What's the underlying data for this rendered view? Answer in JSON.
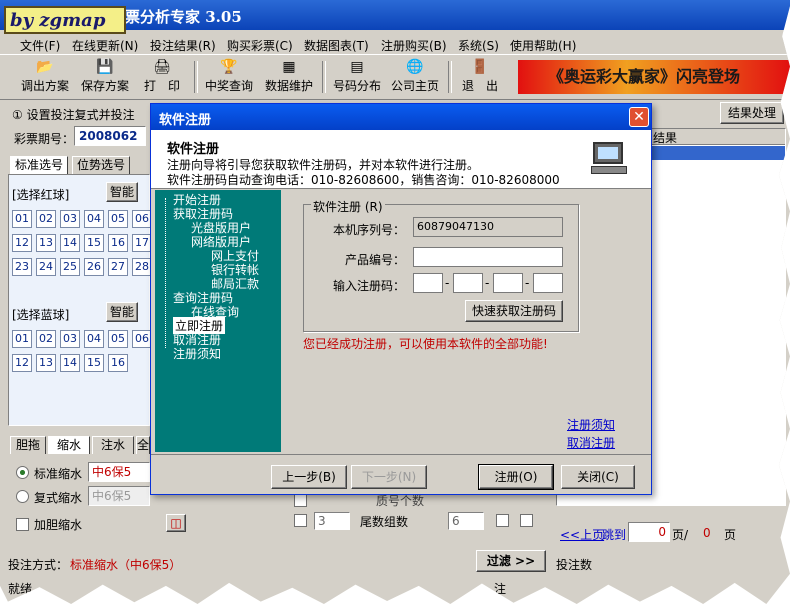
{
  "app": {
    "title": "彩票分析专家 3.05",
    "logo_text": "by zgmap"
  },
  "menu": [
    "文件(F)",
    "在线更新(N)",
    "投注结果(R)",
    "购买彩票(C)",
    "数据图表(T)",
    "注册购买(B)",
    "系统(S)",
    "使用帮助(H)"
  ],
  "toolbar": {
    "items": [
      "调出方案",
      "保存方案",
      "打　印",
      "中奖查询",
      "数据维护",
      "号码分布",
      "公司主页",
      "退　出"
    ],
    "banner": "《奥运彩大赢家》闪亮登场"
  },
  "left": {
    "step_title": "① 设置投注复式并投注",
    "period_label": "彩票期号：",
    "period_value": "2008062",
    "tabs": [
      "标准选号",
      "位势选号"
    ],
    "red_label": "[选择红球]",
    "red_smart": "智能",
    "red_balls": [
      "01",
      "02",
      "03",
      "04",
      "05",
      "06",
      "12",
      "13",
      "14",
      "15",
      "16",
      "17",
      "23",
      "24",
      "25",
      "26",
      "27",
      "28"
    ],
    "blue_label": "[选择蓝球]",
    "blue_smart": "智能",
    "blue_balls": [
      "01",
      "02",
      "03",
      "04",
      "05",
      "06",
      "12",
      "13",
      "14",
      "15",
      "16"
    ],
    "bottom_tabs": [
      "胆拖",
      "缩水",
      "注水",
      "全"
    ],
    "opt_standard": "标准缩水",
    "opt_standard_value": "中6保5",
    "opt_complex": "复式缩水",
    "opt_complex_value": "中6保5",
    "opt_dan": "加胆缩水",
    "bet_mode_label": "投注方式：",
    "bet_mode_value": "标准缩水（中6保5）"
  },
  "middle": {
    "filter_btn": "过滤 >>",
    "row1_label": "质号个数",
    "row2_value": "3",
    "row2_label": "尾数组数",
    "row2_value2": "6"
  },
  "right": {
    "btn": "结果处理",
    "header": "结果",
    "prev_page": "<<上页",
    "jump": "跳到",
    "page_value": "0",
    "page_unit": "页/",
    "total": "0",
    "page_tail": "页",
    "count_label": "投注数"
  },
  "status": {
    "ready": "就绪",
    "note": "注"
  },
  "dialog": {
    "title": "软件注册",
    "head_title": "软件注册",
    "head_line1": "注册向导将引导您获取软件注册码，并对本软件进行注册。",
    "head_line2": "软件注册码自动查询电话：010-82608600，销售咨询：010-82608000",
    "nav": [
      "开始注册",
      "获取注册码",
      "光盘版用户",
      "网络版用户",
      "网上支付",
      "银行转帐",
      "邮局汇款",
      "查询注册码",
      "在线查询",
      "立即注册",
      "取消注册",
      "注册须知"
    ],
    "group_title": "软件注册 (R)",
    "serial_label": "本机序列号：",
    "serial_value": "60879047130",
    "product_label": "产品编号：",
    "product_value": "",
    "code_label": "输入注册码：",
    "code_sep": "-",
    "fast_btn": "快速获取注册码",
    "success_msg": "您已经成功注册，可以使用本软件的全部功能!",
    "link_notes": "注册须知",
    "link_cancel": "取消注册",
    "btn_prev": "上一步(B)",
    "btn_next": "下一步(N)",
    "btn_register": "注册(O)",
    "btn_close": "关闭(C)"
  }
}
